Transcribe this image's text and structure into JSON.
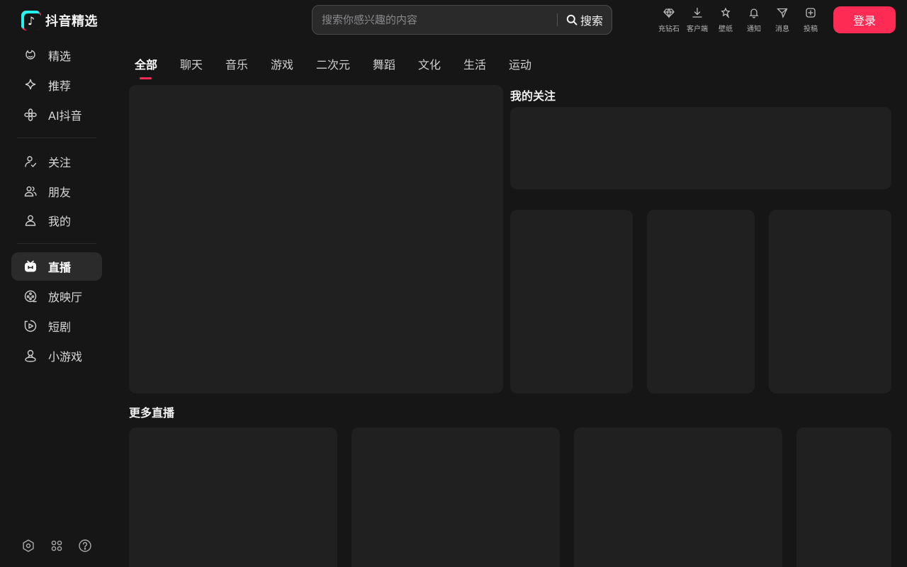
{
  "header": {
    "logo_text": "抖音精选",
    "search": {
      "placeholder": "搜索你感兴趣的内容",
      "button_label": "搜索"
    },
    "tools": [
      {
        "label": "充钻石",
        "icon": "diamond-icon"
      },
      {
        "label": "客户端",
        "icon": "download-icon"
      },
      {
        "label": "壁纸",
        "icon": "wallpaper-icon"
      },
      {
        "label": "通知",
        "icon": "bell-icon"
      },
      {
        "label": "消息",
        "icon": "message-icon"
      },
      {
        "label": "投稿",
        "icon": "upload-icon"
      }
    ],
    "login_label": "登录"
  },
  "sidebar": {
    "items": [
      {
        "label": "精选",
        "icon": "featured-icon"
      },
      {
        "label": "推荐",
        "icon": "sparkle-icon"
      },
      {
        "label": "AI抖音",
        "icon": "flower-icon"
      },
      {
        "label": "关注",
        "icon": "follow-icon"
      },
      {
        "label": "朋友",
        "icon": "friends-icon"
      },
      {
        "label": "我的",
        "icon": "user-icon"
      },
      {
        "label": "直播",
        "icon": "live-tv-icon",
        "active": true
      },
      {
        "label": "放映厅",
        "icon": "film-reel-icon"
      },
      {
        "label": "短剧",
        "icon": "play-drama-icon"
      },
      {
        "label": "小游戏",
        "icon": "game-icon"
      }
    ],
    "bottom_icons": [
      "settings-icon",
      "apps-icon",
      "help-icon"
    ]
  },
  "tabs": [
    "全部",
    "聊天",
    "音乐",
    "游戏",
    "二次元",
    "舞蹈",
    "文化",
    "生活",
    "运动"
  ],
  "active_tab": "全部",
  "sections": {
    "my_follow_title": "我的关注",
    "more_live_title": "更多直播"
  },
  "colors": {
    "accent": "#fe2c55",
    "background": "#161616",
    "card": "#202020"
  }
}
